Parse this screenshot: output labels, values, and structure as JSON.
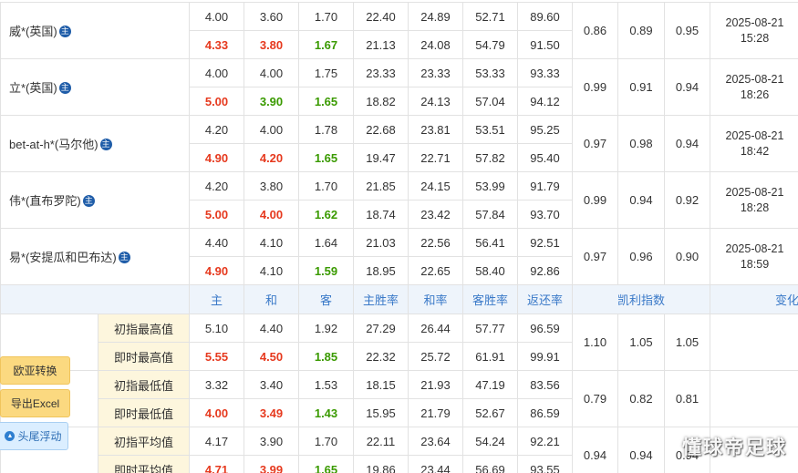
{
  "companies": [
    {
      "name": "威*(英国)",
      "flag": "主",
      "init": [
        "4.00",
        "3.60",
        "1.70",
        "22.40",
        "24.89",
        "52.71",
        "89.60"
      ],
      "live": [
        "4.33",
        "3.80",
        "1.67",
        "21.13",
        "24.08",
        "54.79",
        "91.50"
      ],
      "kelly": [
        "0.86",
        "0.89",
        "0.95"
      ],
      "date": "2025-08-21",
      "time": "15:28"
    },
    {
      "name": "立*(英国)",
      "flag": "主",
      "init": [
        "4.00",
        "4.00",
        "1.75",
        "23.33",
        "23.33",
        "53.33",
        "93.33"
      ],
      "live": [
        "5.00",
        "3.90",
        "1.65",
        "18.82",
        "24.13",
        "57.04",
        "94.12"
      ],
      "kelly": [
        "0.99",
        "0.91",
        "0.94"
      ],
      "date": "2025-08-21",
      "time": "18:26"
    },
    {
      "name": "bet-at-h*(马尔他)",
      "flag": "主",
      "init": [
        "4.20",
        "4.00",
        "1.78",
        "22.68",
        "23.81",
        "53.51",
        "95.25"
      ],
      "live": [
        "4.90",
        "4.20",
        "1.65",
        "19.47",
        "22.71",
        "57.82",
        "95.40"
      ],
      "kelly": [
        "0.97",
        "0.98",
        "0.94"
      ],
      "date": "2025-08-21",
      "time": "18:42"
    },
    {
      "name": "伟*(直布罗陀)",
      "flag": "主",
      "init": [
        "4.20",
        "3.80",
        "1.70",
        "21.85",
        "24.15",
        "53.99",
        "91.79"
      ],
      "live": [
        "5.00",
        "4.00",
        "1.62",
        "18.74",
        "23.42",
        "57.84",
        "93.70"
      ],
      "kelly": [
        "0.99",
        "0.94",
        "0.92"
      ],
      "date": "2025-08-21",
      "time": "18:28"
    },
    {
      "name": "易*(安提瓜和巴布达)",
      "flag": "主",
      "init": [
        "4.40",
        "4.10",
        "1.64",
        "21.03",
        "22.56",
        "56.41",
        "92.51"
      ],
      "live": [
        "4.90",
        "4.10",
        "1.59",
        "18.95",
        "22.65",
        "58.40",
        "92.86"
      ],
      "kelly": [
        "0.97",
        "0.96",
        "0.90"
      ],
      "date": "2025-08-21",
      "time": "18:59"
    }
  ],
  "header": {
    "home": "主",
    "draw": "和",
    "away": "客",
    "home_rate": "主胜率",
    "draw_rate": "和率",
    "away_rate": "客胜率",
    "return_rate": "返还率",
    "kelly": "凯利指数",
    "change": "变化"
  },
  "stats": [
    {
      "init_label": "初指最高值",
      "init": [
        "5.10",
        "4.40",
        "1.92",
        "27.29",
        "26.44",
        "57.77",
        "96.59"
      ],
      "live_label": "即时最高值",
      "live": [
        "5.55",
        "4.50",
        "1.85",
        "22.32",
        "25.72",
        "61.91",
        "99.91"
      ],
      "kelly": [
        "1.10",
        "1.05",
        "1.05"
      ]
    },
    {
      "init_label": "初指最低值",
      "init": [
        "3.32",
        "3.40",
        "1.53",
        "18.15",
        "21.93",
        "47.19",
        "83.56"
      ],
      "live_label": "即时最低值",
      "live": [
        "4.00",
        "3.49",
        "1.43",
        "15.95",
        "21.79",
        "52.67",
        "86.59"
      ],
      "kelly": [
        "0.79",
        "0.82",
        "0.81"
      ]
    },
    {
      "init_label": "初指平均值",
      "init": [
        "4.17",
        "3.90",
        "1.70",
        "22.11",
        "23.64",
        "54.24",
        "92.21"
      ],
      "live_label": "即时平均值",
      "live": [
        "4.71",
        "3.99",
        "1.65",
        "19.86",
        "23.44",
        "56.69",
        "93.55"
      ],
      "kelly": [
        "0.94",
        "0.94",
        "0.94"
      ]
    }
  ],
  "buttons": {
    "euro_asia": "欧亚转换",
    "export": "导出Excel",
    "float": "头尾浮动"
  },
  "icons": {
    "flag": "home-flag-icon",
    "float": "float-icon"
  },
  "colors": {
    "up": "#e6391e",
    "down": "#3a9a00",
    "band": "#eef4fb",
    "label_bg": "#fdf6dd"
  },
  "watermark": "懂球帝足球"
}
